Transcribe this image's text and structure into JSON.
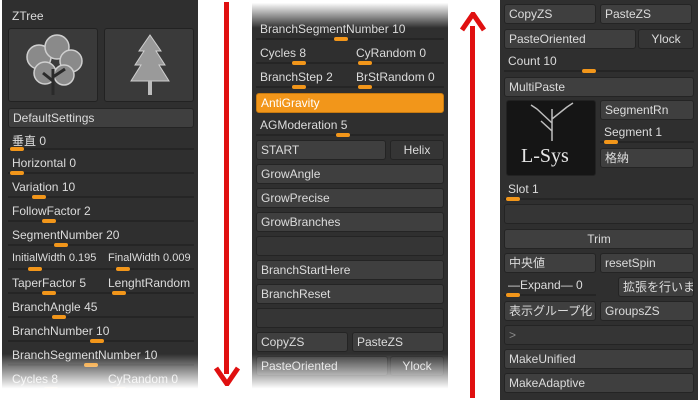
{
  "panel1": {
    "title": "ZTree",
    "default_settings": "DefaultSettings",
    "params": [
      {
        "label": "垂直",
        "value": "0"
      },
      {
        "label": "Horizontal",
        "value": "0"
      },
      {
        "label": "Variation",
        "value": "10"
      },
      {
        "label": "FollowFactor",
        "value": "2"
      },
      {
        "label": "SegmentNumber",
        "value": "20"
      }
    ],
    "initial_width": {
      "label": "InitialWidth",
      "value": "0.195"
    },
    "final_width": {
      "label": "FinalWidth",
      "value": "0.009"
    },
    "taper_factor": {
      "label": "TaperFactor",
      "value": "5"
    },
    "length_random": {
      "label": "LenghtRandom",
      "value": ""
    },
    "branch_angle": {
      "label": "BranchAngle",
      "value": "45"
    },
    "branch_number": {
      "label": "BranchNumber",
      "value": "10"
    },
    "branch_segment_number": {
      "label": "BranchSegmentNumber",
      "value": "10"
    },
    "cycles": {
      "label": "Cycles",
      "value": "8"
    },
    "cy_random": {
      "label": "CyRandom",
      "value": "0"
    }
  },
  "panel2": {
    "branch_segment_number": {
      "label": "BranchSegmentNumber",
      "value": "10"
    },
    "cycles": {
      "label": "Cycles",
      "value": "8"
    },
    "cy_random": {
      "label": "CyRandom",
      "value": "0"
    },
    "branch_step": {
      "label": "BranchStep",
      "value": "2"
    },
    "br_st_random": {
      "label": "BrStRandom",
      "value": "0"
    },
    "anti_gravity": "AntiGravity",
    "ag_moderation": {
      "label": "AGModeration",
      "value": "5"
    },
    "start": "START",
    "helix": "Helix",
    "grow_angle": "GrowAngle",
    "grow_precise": "GrowPrecise",
    "grow_branches": "GrowBranches",
    "branch_start_here": "BranchStartHere",
    "branch_reset": "BranchReset",
    "copy_zs": "CopyZS",
    "paste_zs": "PasteZS",
    "paste_oriented": "PasteOriented",
    "ylock": "Ylock"
  },
  "panel3": {
    "copy_zs": "CopyZS",
    "paste_zs": "PasteZS",
    "paste_oriented": "PasteOriented",
    "ylock": "Ylock",
    "count": {
      "label": "Count",
      "value": "10"
    },
    "multi_paste": "MultiPaste",
    "logo_text": "L-Sys",
    "segment_rn": "SegmentRn",
    "segment": {
      "label": "Segment",
      "value": "1"
    },
    "store": "格納",
    "slot": {
      "label": "Slot",
      "value": "1"
    },
    "trim": "Trim",
    "center_axis": "中央値",
    "reset_spin": "resetSpin",
    "expand": "—Expand—",
    "expand_value": "0",
    "expand_btn": "拡張を行います",
    "show_group": "表示グループ化",
    "groups_zs": "GroupsZS",
    "chevron": ">",
    "make_unified": "MakeUnified",
    "make_adaptive": "MakeAdaptive"
  },
  "colors": {
    "accent": "#f2961a",
    "panel": "#2f2f2f",
    "button": "#3f3f3f",
    "arrow": "#e01010"
  }
}
